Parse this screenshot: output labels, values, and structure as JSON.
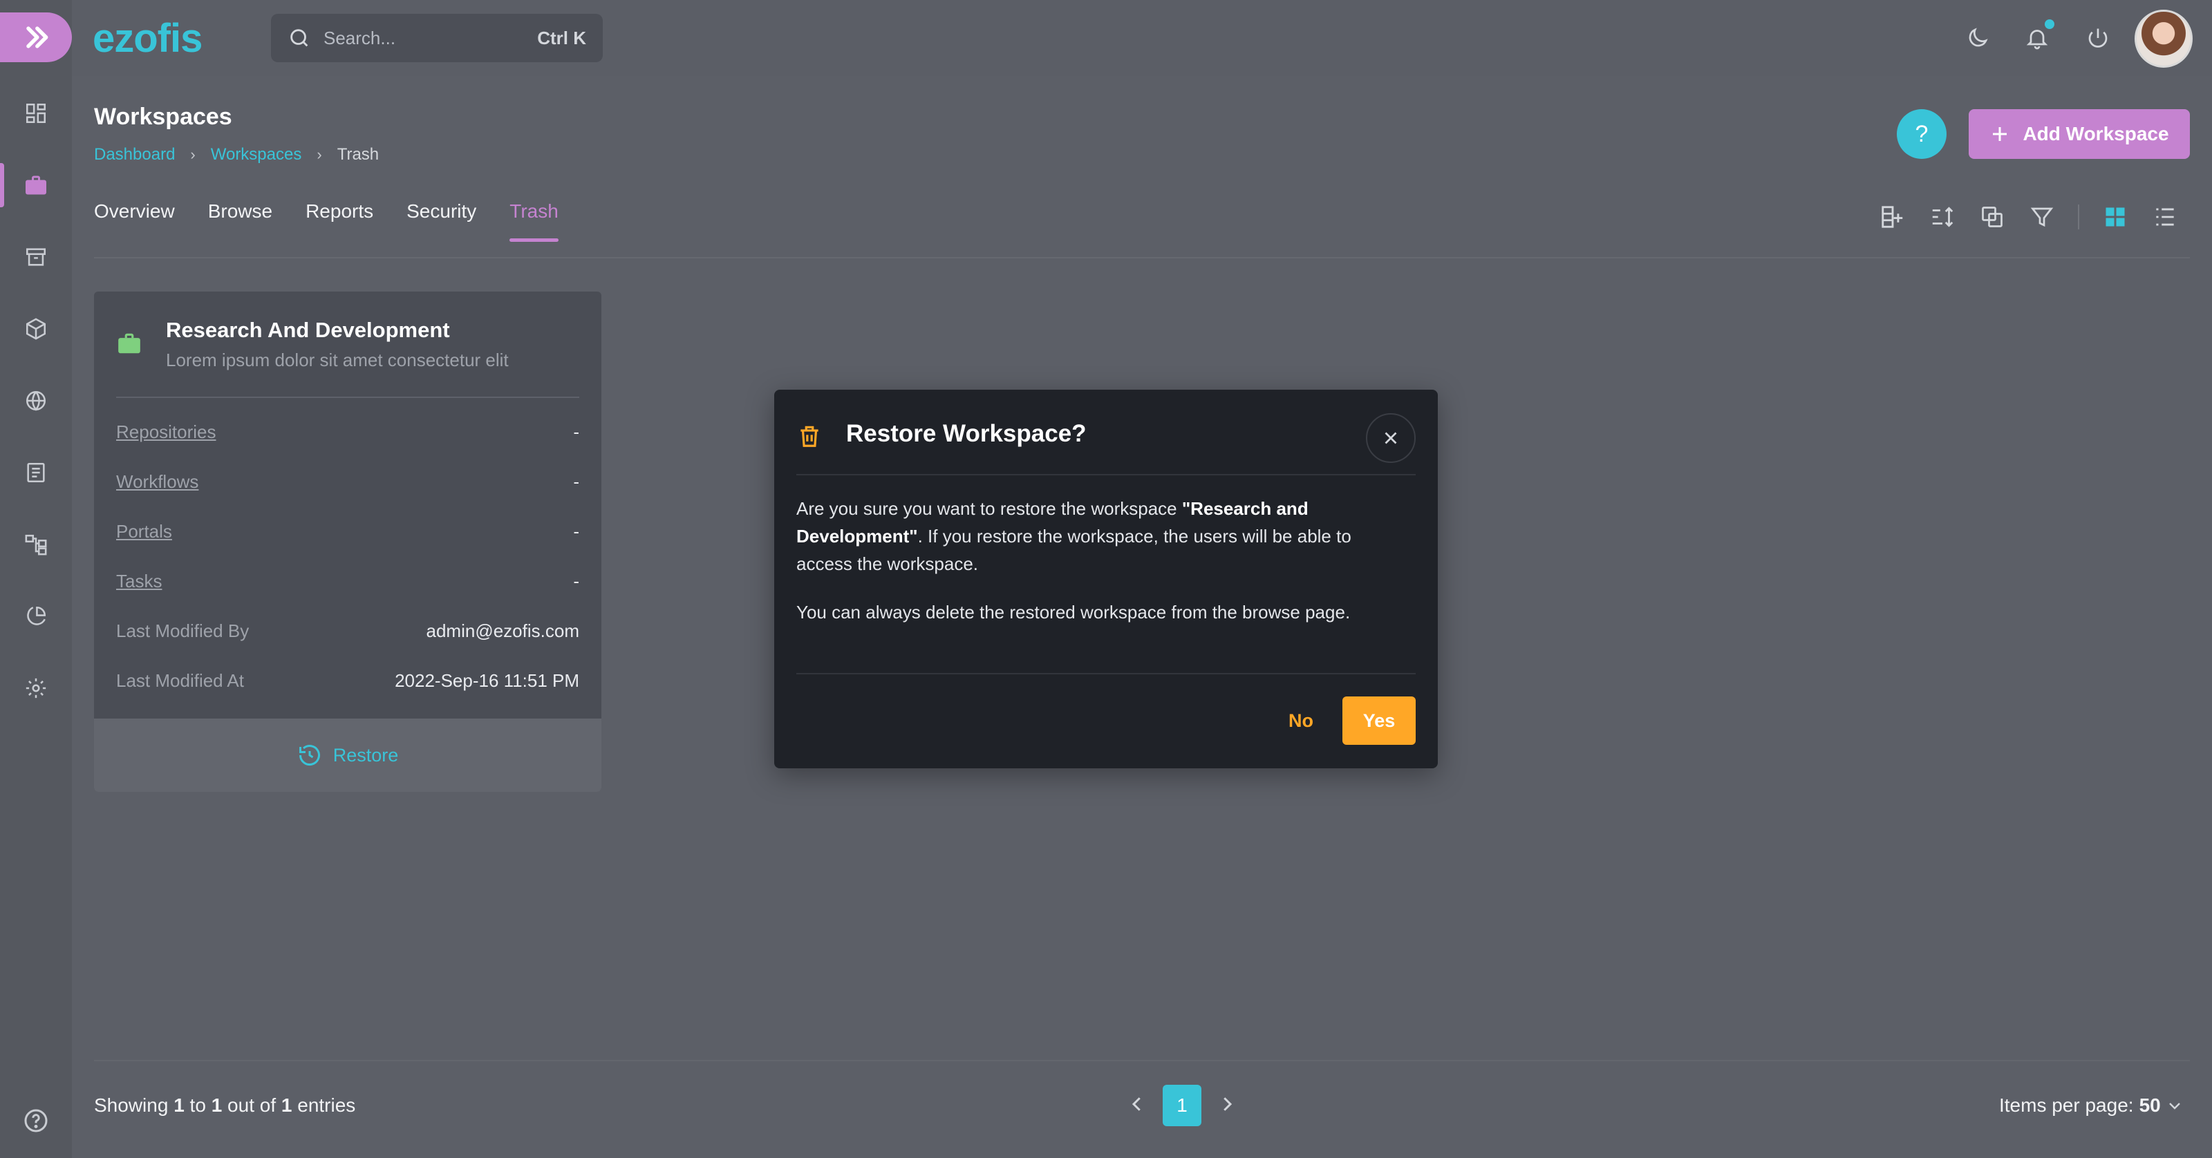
{
  "app": {
    "brand": "ezofis"
  },
  "colors": {
    "accent": "#c583d0",
    "primary": "#39c4d8",
    "warning": "#ffa726",
    "success": "#7fd07f"
  },
  "search": {
    "placeholder": "Search...",
    "shortcut": "Ctrl K"
  },
  "sidebar": {
    "items": [
      {
        "name": "dashboard-icon"
      },
      {
        "name": "workspaces-briefcase-icon",
        "active": true
      },
      {
        "name": "archive-icon"
      },
      {
        "name": "cube-icon"
      },
      {
        "name": "globe-icon"
      },
      {
        "name": "document-list-icon"
      },
      {
        "name": "workflow-icon"
      },
      {
        "name": "pie-chart-icon"
      },
      {
        "name": "settings-gear-icon"
      }
    ],
    "help_icon": "help-circle-icon"
  },
  "topbar": {
    "icons": [
      "moon-icon",
      "bell-icon",
      "power-icon"
    ]
  },
  "page": {
    "title": "Workspaces",
    "breadcrumb": [
      "Dashboard",
      "Workspaces",
      "Trash"
    ],
    "add_button": "Add Workspace",
    "help_button": "?"
  },
  "tabs": [
    {
      "label": "Overview"
    },
    {
      "label": "Browse"
    },
    {
      "label": "Reports"
    },
    {
      "label": "Security"
    },
    {
      "label": "Trash",
      "active": true
    }
  ],
  "toolbar": [
    "add-column-icon",
    "sort-icon",
    "group-icon",
    "filter-icon",
    "grid-view-icon",
    "list-view-icon"
  ],
  "card": {
    "title": "Research And Development",
    "description": "Lorem ipsum dolor sit amet consectetur elit",
    "rows": [
      {
        "label": "Repositories",
        "value": "-"
      },
      {
        "label": "Workflows",
        "value": "-"
      },
      {
        "label": "Portals",
        "value": "-"
      },
      {
        "label": "Tasks",
        "value": "-"
      },
      {
        "label": "Last Modified By",
        "value": "admin@ezofis.com"
      },
      {
        "label": "Last Modified At",
        "value": "2022-Sep-16 11:51 PM"
      }
    ],
    "restore_label": "Restore"
  },
  "modal": {
    "title": "Restore Workspace?",
    "body_prefix": "Are you sure you want to restore the workspace ",
    "body_name": "\"Research and Development\"",
    "body_suffix": ". If you restore the workspace, the users will be able to access the workspace.",
    "body_note": "You can always delete the restored workspace from the browse page.",
    "no_label": "No",
    "yes_label": "Yes"
  },
  "footer": {
    "showing_prefix": "Showing ",
    "from": "1",
    "to_word": " to ",
    "to": "1",
    "of_word": " out of ",
    "total": "1",
    "entries_word": " entries",
    "current_page": "1",
    "items_per_page_label": "Items per page: ",
    "items_per_page_value": "50"
  }
}
